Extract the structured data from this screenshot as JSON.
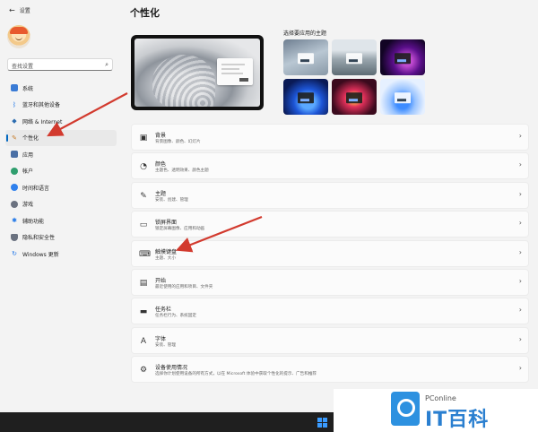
{
  "window": {
    "title": "设置"
  },
  "sidebar": {
    "search_placeholder": "查找设置",
    "items": [
      {
        "label": "系统",
        "icon": "monitor-icon",
        "color": "#3a7bd5"
      },
      {
        "label": "蓝牙和其他设备",
        "icon": "bluetooth-icon",
        "color": "#1a73e8"
      },
      {
        "label": "网络 & Internet",
        "icon": "wifi-icon",
        "color": "#2b6cb0"
      },
      {
        "label": "个性化",
        "icon": "brush-icon",
        "color": "#c77d2b",
        "active": true
      },
      {
        "label": "应用",
        "icon": "apps-icon",
        "color": "#4a6fa5"
      },
      {
        "label": "帐户",
        "icon": "account-icon",
        "color": "#2f9e6e"
      },
      {
        "label": "时间和语言",
        "icon": "globe-clock-icon",
        "color": "#2f80ed"
      },
      {
        "label": "游戏",
        "icon": "gamepad-icon",
        "color": "#6b7280"
      },
      {
        "label": "辅助功能",
        "icon": "accessibility-icon",
        "color": "#1a73e8"
      },
      {
        "label": "隐私和安全性",
        "icon": "shield-icon",
        "color": "#6b7280"
      },
      {
        "label": "Windows 更新",
        "icon": "update-icon",
        "color": "#1a73e8"
      }
    ]
  },
  "main": {
    "title": "个性化",
    "themes_label": "选择要应用的主题",
    "settings": [
      {
        "title": "背景",
        "desc": "背景图像、颜色、幻灯片",
        "icon": "image-icon"
      },
      {
        "title": "颜色",
        "desc": "主题色、透明效果、颜色主题",
        "icon": "palette-icon"
      },
      {
        "title": "主题",
        "desc": "安装、创建、管理",
        "icon": "pen-icon"
      },
      {
        "title": "锁屏界面",
        "desc": "锁定屏幕图像、应用和动画",
        "icon": "lock-screen-icon"
      },
      {
        "title": "触摸键盘",
        "desc": "主题、大小",
        "icon": "keyboard-icon"
      },
      {
        "title": "开始",
        "desc": "最近使用的应用和项目、文件夹",
        "icon": "start-icon"
      },
      {
        "title": "任务栏",
        "desc": "任务栏行为、系统固定",
        "icon": "taskbar-icon"
      },
      {
        "title": "字体",
        "desc": "安装、管理",
        "icon": "font-icon"
      },
      {
        "title": "设备使用情况",
        "desc": "选择你计划使用设备的所有方式，以在 Microsoft 体验中获取个性化的提示、广告和推荐",
        "icon": "device-usage-icon"
      }
    ]
  },
  "watermark": {
    "brand": "PConline",
    "name": "IT百科"
  },
  "annotation_color": "#d23a2e"
}
